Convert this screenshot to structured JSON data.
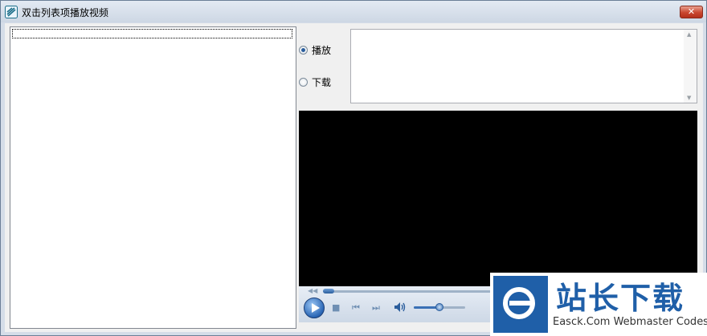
{
  "window": {
    "title": "双击列表项播放视频",
    "close_label": "✕"
  },
  "options": {
    "play_label": "播放",
    "download_label": "下载",
    "selected": "播放"
  },
  "player": {
    "seek_position": 0.0,
    "volume": 0.5
  },
  "watermark": {
    "cn_text": "站长下载",
    "en_text": "Easck.Com Webmaster Codes"
  }
}
